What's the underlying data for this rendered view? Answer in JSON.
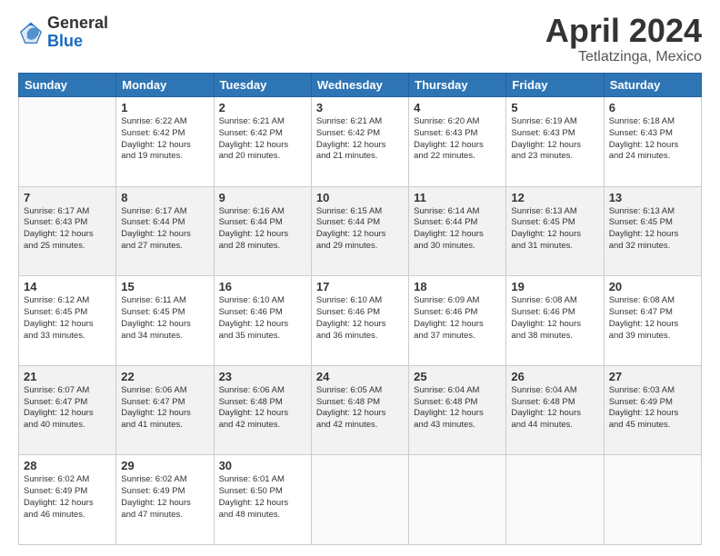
{
  "header": {
    "logo_general": "General",
    "logo_blue": "Blue",
    "title": "April 2024",
    "location": "Tetlatzinga, Mexico"
  },
  "calendar": {
    "days_of_week": [
      "Sunday",
      "Monday",
      "Tuesday",
      "Wednesday",
      "Thursday",
      "Friday",
      "Saturday"
    ],
    "weeks": [
      [
        {
          "day": "",
          "info": ""
        },
        {
          "day": "1",
          "info": "Sunrise: 6:22 AM\nSunset: 6:42 PM\nDaylight: 12 hours\nand 19 minutes."
        },
        {
          "day": "2",
          "info": "Sunrise: 6:21 AM\nSunset: 6:42 PM\nDaylight: 12 hours\nand 20 minutes."
        },
        {
          "day": "3",
          "info": "Sunrise: 6:21 AM\nSunset: 6:42 PM\nDaylight: 12 hours\nand 21 minutes."
        },
        {
          "day": "4",
          "info": "Sunrise: 6:20 AM\nSunset: 6:43 PM\nDaylight: 12 hours\nand 22 minutes."
        },
        {
          "day": "5",
          "info": "Sunrise: 6:19 AM\nSunset: 6:43 PM\nDaylight: 12 hours\nand 23 minutes."
        },
        {
          "day": "6",
          "info": "Sunrise: 6:18 AM\nSunset: 6:43 PM\nDaylight: 12 hours\nand 24 minutes."
        }
      ],
      [
        {
          "day": "7",
          "info": "Sunrise: 6:17 AM\nSunset: 6:43 PM\nDaylight: 12 hours\nand 25 minutes."
        },
        {
          "day": "8",
          "info": "Sunrise: 6:17 AM\nSunset: 6:44 PM\nDaylight: 12 hours\nand 27 minutes."
        },
        {
          "day": "9",
          "info": "Sunrise: 6:16 AM\nSunset: 6:44 PM\nDaylight: 12 hours\nand 28 minutes."
        },
        {
          "day": "10",
          "info": "Sunrise: 6:15 AM\nSunset: 6:44 PM\nDaylight: 12 hours\nand 29 minutes."
        },
        {
          "day": "11",
          "info": "Sunrise: 6:14 AM\nSunset: 6:44 PM\nDaylight: 12 hours\nand 30 minutes."
        },
        {
          "day": "12",
          "info": "Sunrise: 6:13 AM\nSunset: 6:45 PM\nDaylight: 12 hours\nand 31 minutes."
        },
        {
          "day": "13",
          "info": "Sunrise: 6:13 AM\nSunset: 6:45 PM\nDaylight: 12 hours\nand 32 minutes."
        }
      ],
      [
        {
          "day": "14",
          "info": "Sunrise: 6:12 AM\nSunset: 6:45 PM\nDaylight: 12 hours\nand 33 minutes."
        },
        {
          "day": "15",
          "info": "Sunrise: 6:11 AM\nSunset: 6:45 PM\nDaylight: 12 hours\nand 34 minutes."
        },
        {
          "day": "16",
          "info": "Sunrise: 6:10 AM\nSunset: 6:46 PM\nDaylight: 12 hours\nand 35 minutes."
        },
        {
          "day": "17",
          "info": "Sunrise: 6:10 AM\nSunset: 6:46 PM\nDaylight: 12 hours\nand 36 minutes."
        },
        {
          "day": "18",
          "info": "Sunrise: 6:09 AM\nSunset: 6:46 PM\nDaylight: 12 hours\nand 37 minutes."
        },
        {
          "day": "19",
          "info": "Sunrise: 6:08 AM\nSunset: 6:46 PM\nDaylight: 12 hours\nand 38 minutes."
        },
        {
          "day": "20",
          "info": "Sunrise: 6:08 AM\nSunset: 6:47 PM\nDaylight: 12 hours\nand 39 minutes."
        }
      ],
      [
        {
          "day": "21",
          "info": "Sunrise: 6:07 AM\nSunset: 6:47 PM\nDaylight: 12 hours\nand 40 minutes."
        },
        {
          "day": "22",
          "info": "Sunrise: 6:06 AM\nSunset: 6:47 PM\nDaylight: 12 hours\nand 41 minutes."
        },
        {
          "day": "23",
          "info": "Sunrise: 6:06 AM\nSunset: 6:48 PM\nDaylight: 12 hours\nand 42 minutes."
        },
        {
          "day": "24",
          "info": "Sunrise: 6:05 AM\nSunset: 6:48 PM\nDaylight: 12 hours\nand 42 minutes."
        },
        {
          "day": "25",
          "info": "Sunrise: 6:04 AM\nSunset: 6:48 PM\nDaylight: 12 hours\nand 43 minutes."
        },
        {
          "day": "26",
          "info": "Sunrise: 6:04 AM\nSunset: 6:48 PM\nDaylight: 12 hours\nand 44 minutes."
        },
        {
          "day": "27",
          "info": "Sunrise: 6:03 AM\nSunset: 6:49 PM\nDaylight: 12 hours\nand 45 minutes."
        }
      ],
      [
        {
          "day": "28",
          "info": "Sunrise: 6:02 AM\nSunset: 6:49 PM\nDaylight: 12 hours\nand 46 minutes."
        },
        {
          "day": "29",
          "info": "Sunrise: 6:02 AM\nSunset: 6:49 PM\nDaylight: 12 hours\nand 47 minutes."
        },
        {
          "day": "30",
          "info": "Sunrise: 6:01 AM\nSunset: 6:50 PM\nDaylight: 12 hours\nand 48 minutes."
        },
        {
          "day": "",
          "info": ""
        },
        {
          "day": "",
          "info": ""
        },
        {
          "day": "",
          "info": ""
        },
        {
          "day": "",
          "info": ""
        }
      ]
    ]
  }
}
